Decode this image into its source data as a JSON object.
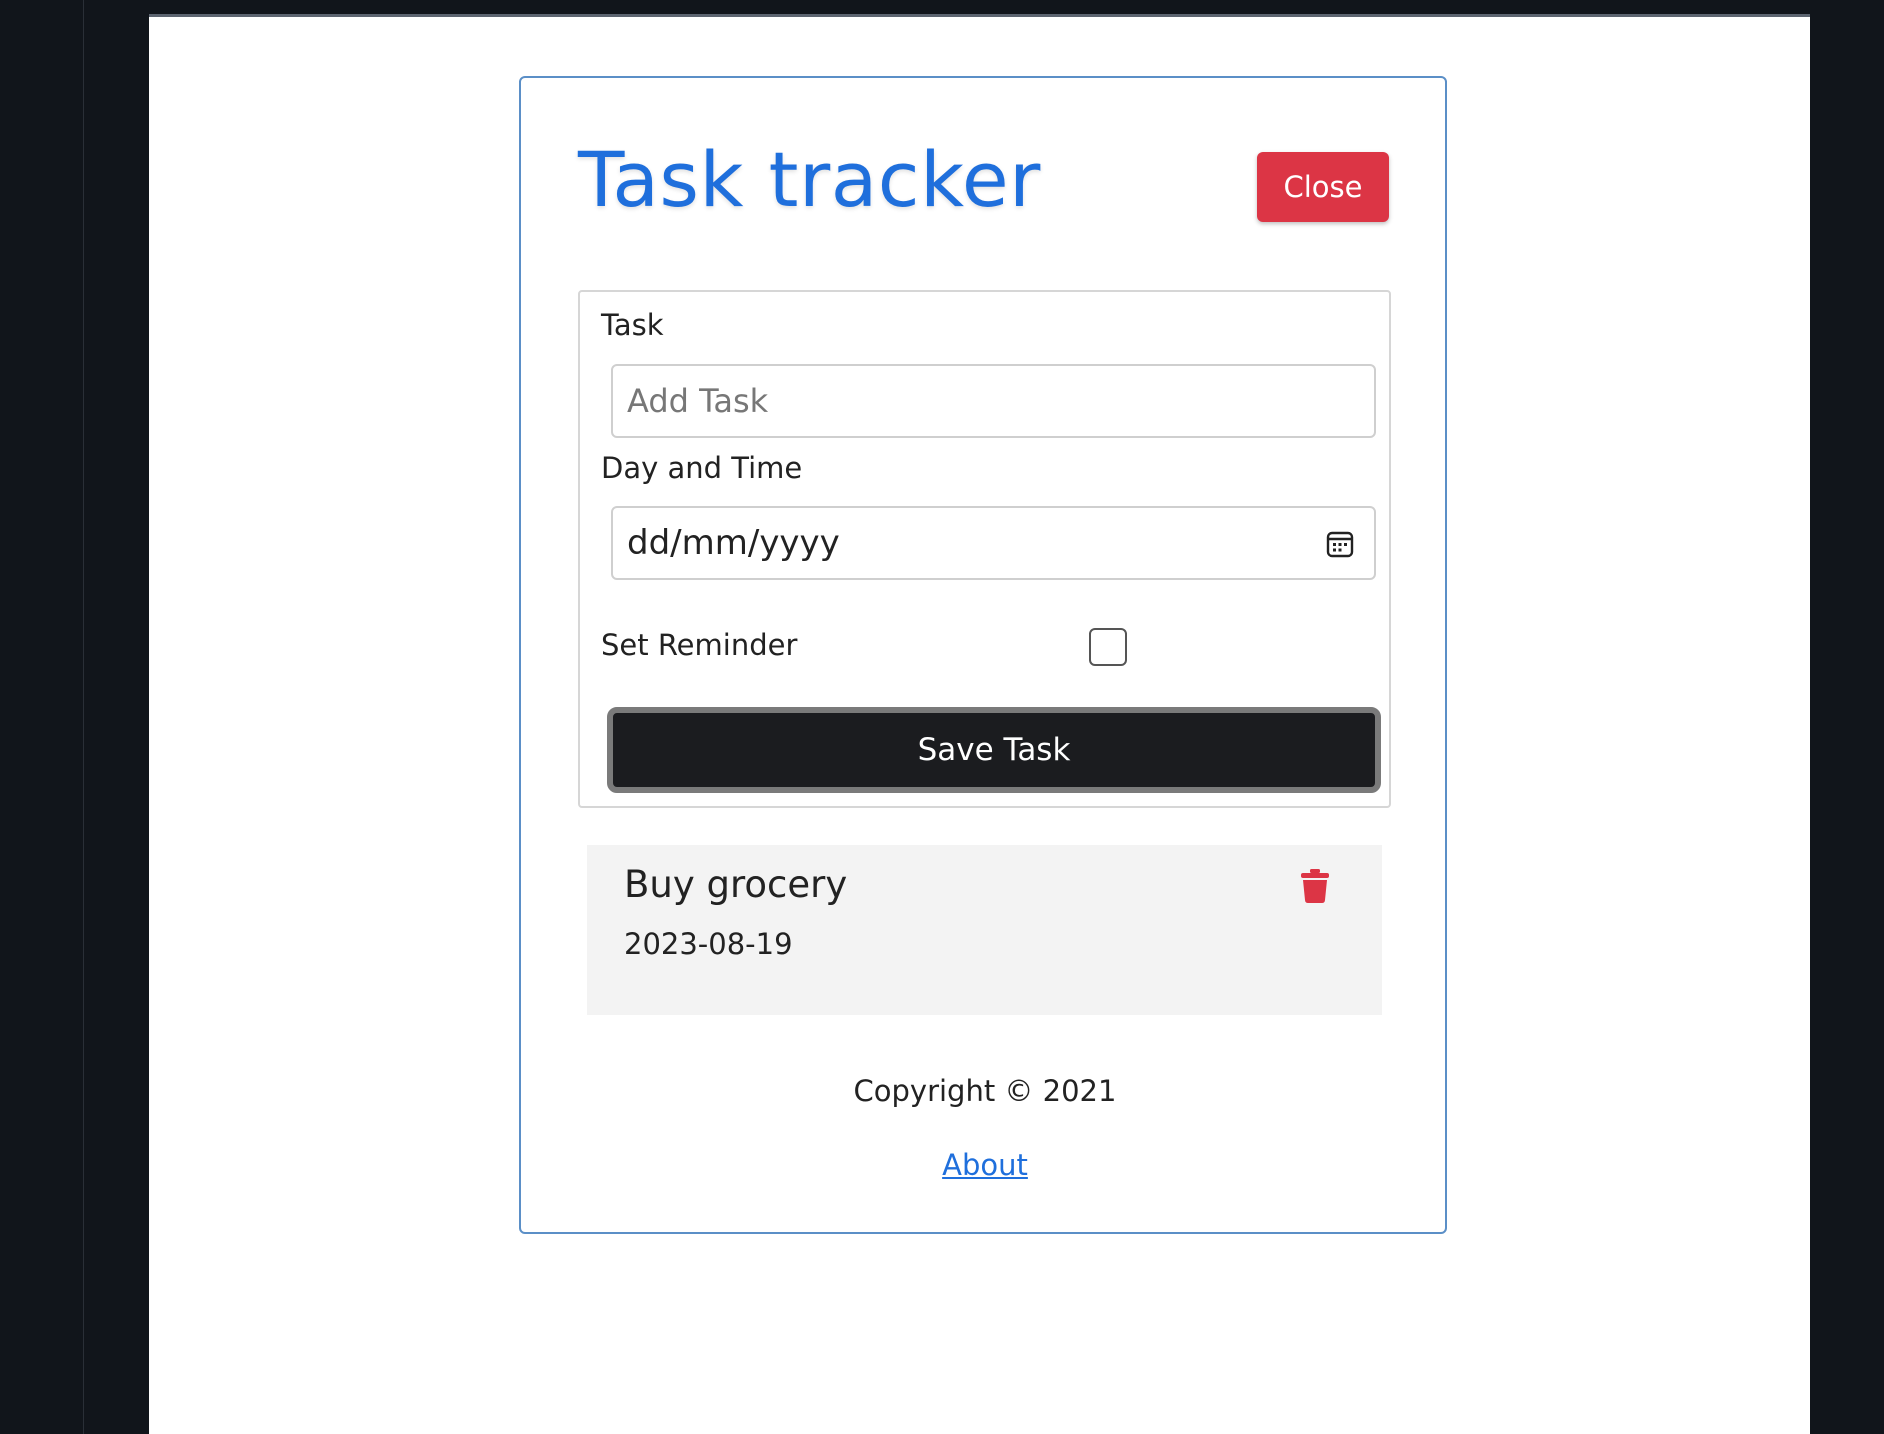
{
  "app": {
    "title": "Task tracker",
    "close_label": "Close"
  },
  "form": {
    "task_label": "Task",
    "task_placeholder": "Add Task",
    "task_value": "",
    "day_time_label": "Day and Time",
    "date_placeholder": "dd/mm/yyyy",
    "reminder_label": "Set Reminder",
    "reminder_checked": false,
    "save_label": "Save Task"
  },
  "tasks": [
    {
      "title": "Buy grocery",
      "date": "2023-08-19"
    }
  ],
  "footer": {
    "copyright": "Copyright © 2021",
    "about_link": "About"
  },
  "colors": {
    "accent": "#1f6fdc",
    "danger": "#dc3545",
    "save_button": "#1b1c1f"
  },
  "icons": {
    "date_picker": "calendar-icon",
    "delete_task": "trash-icon"
  }
}
